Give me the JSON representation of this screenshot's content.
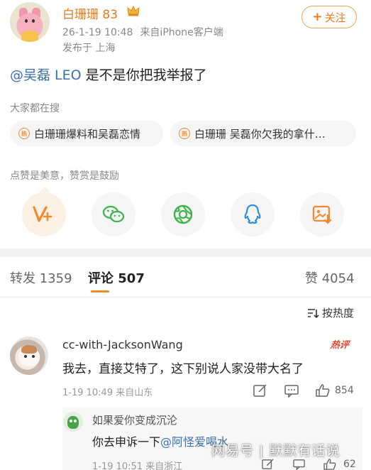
{
  "header": {
    "username": "白珊珊 83",
    "timestamp": "26-1-19 10:48",
    "source": "来自iPhone客户端",
    "location": "发布于 上海",
    "follow_label": "关注"
  },
  "post": {
    "mention": "@吴磊 LEO",
    "text": " 是不是你把我举报了"
  },
  "trending": {
    "label": "大家都在搜",
    "items": [
      {
        "text": "白珊珊爆料和吴磊恋情"
      },
      {
        "text": "白珊珊 吴磊你欠我的拿什…"
      }
    ]
  },
  "reward": {
    "label": "点赞是美意，赞赏是鼓励"
  },
  "share_icons": [
    "v-plus-icon",
    "wechat-icon",
    "moments-icon",
    "qq-icon",
    "save-image-icon"
  ],
  "tabs": {
    "repost_label": "转发",
    "repost_count": "1359",
    "comment_label": "评论",
    "comment_count": "507",
    "like_label": "赞",
    "like_count": "4054"
  },
  "sort": {
    "label": "按热度"
  },
  "comment": {
    "username": "cc-with-JacksonWang",
    "tag": "热评",
    "text": "我去，直接艾特了，这下别说人家没带大名了",
    "time": "1-19 10:49",
    "location": "来自山东",
    "likes": "854"
  },
  "reply": {
    "username": "如果爱你变成沉沦",
    "text_prefix": "你去申诉一下",
    "mention": "@阿怪爱喝水",
    "time": "1-19 10:51",
    "location": "来自浙江",
    "likes": "62"
  },
  "watermark": "网易号 | 默默有话说",
  "colors": {
    "accent": "#ea7b1a",
    "link": "#3a6fb0",
    "hot": "#e8452e"
  }
}
